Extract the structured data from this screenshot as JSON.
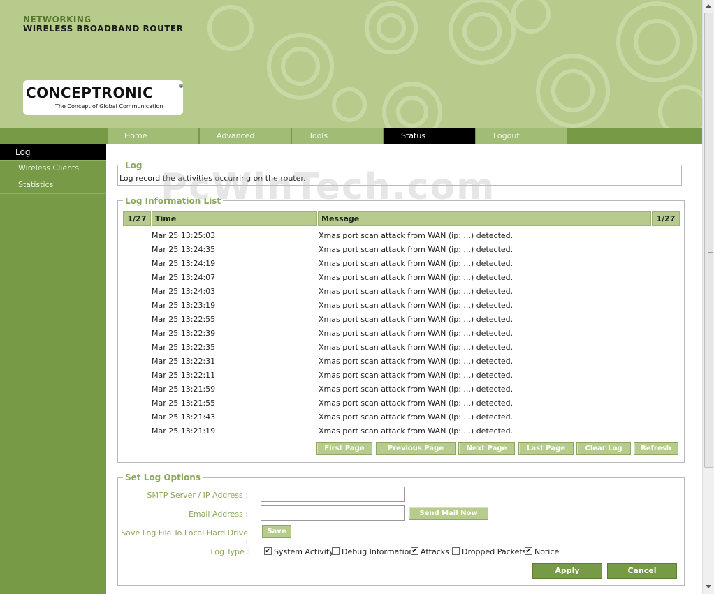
{
  "header": {
    "networking": "NETWORKING",
    "product": "WIRELESS BROADBAND ROUTER",
    "brand": "CONCEPTRONIC",
    "brand_registered": "®",
    "tagline": "The Concept of Global Communication"
  },
  "nav": {
    "tabs": [
      {
        "label": "Home"
      },
      {
        "label": "Advanced"
      },
      {
        "label": "Tools"
      },
      {
        "label": "Status"
      },
      {
        "label": "Logout"
      }
    ],
    "active": "Status"
  },
  "sidebar": {
    "items": [
      {
        "label": "Log"
      },
      {
        "label": "Wireless Clients"
      },
      {
        "label": "Statistics"
      }
    ],
    "active": "Log"
  },
  "log_section": {
    "legend": "Log",
    "description": "Log record the activities occurring on the router."
  },
  "watermark": "PcWinTech.com",
  "log_list": {
    "legend": "Log Information List",
    "page_left": "1/27",
    "page_right": "1/27",
    "col_time": "Time",
    "col_message": "Message",
    "rows": [
      {
        "time": "Mar 25 13:25:03",
        "message": "Xmas port scan attack from WAN (ip:  ...) detected."
      },
      {
        "time": "Mar 25 13:24:35",
        "message": "Xmas port scan attack from WAN (ip:  ...) detected."
      },
      {
        "time": "Mar 25 13:24:19",
        "message": "Xmas port scan attack from WAN (ip:  ...) detected."
      },
      {
        "time": "Mar 25 13:24:07",
        "message": "Xmas port scan attack from WAN (ip:  ...) detected."
      },
      {
        "time": "Mar 25 13:24:03",
        "message": "Xmas port scan attack from WAN (ip:  ...) detected."
      },
      {
        "time": "Mar 25 13:23:19",
        "message": "Xmas port scan attack from WAN (ip:  ...) detected."
      },
      {
        "time": "Mar 25 13:22:55",
        "message": "Xmas port scan attack from WAN (ip:  ...) detected."
      },
      {
        "time": "Mar 25 13:22:39",
        "message": "Xmas port scan attack from WAN (ip:  ...) detected."
      },
      {
        "time": "Mar 25 13:22:35",
        "message": "Xmas port scan attack from WAN (ip:  ...) detected."
      },
      {
        "time": "Mar 25 13:22:31",
        "message": "Xmas port scan attack from WAN (ip:  ...) detected."
      },
      {
        "time": "Mar 25 13:22:11",
        "message": "Xmas port scan attack from WAN (ip:  ...) detected."
      },
      {
        "time": "Mar 25 13:21:59",
        "message": "Xmas port scan attack from WAN (ip:  ...) detected."
      },
      {
        "time": "Mar 25 13:21:55",
        "message": "Xmas port scan attack from WAN (ip:  ...) detected."
      },
      {
        "time": "Mar 25 13:21:43",
        "message": "Xmas port scan attack from WAN (ip:  ...) detected."
      },
      {
        "time": "Mar 25 13:21:19",
        "message": "Xmas port scan attack from WAN (ip:  ...) detected."
      }
    ],
    "buttons": {
      "first": "First Page",
      "previous": "Previous Page",
      "next": "Next Page",
      "last": "Last Page",
      "clear": "Clear Log",
      "refresh": "Refresh"
    }
  },
  "options": {
    "legend": "Set Log Options",
    "smtp_label": "SMTP Server / IP Address :",
    "smtp_value": "",
    "email_label": "Email Address :",
    "email_value": "",
    "send_mail": "Send Mail Now",
    "save_label": "Save Log File To Local Hard Drive :",
    "save_button": "Save",
    "log_type_label": "Log Type :",
    "log_types": [
      {
        "label": "System Activity",
        "checked": true
      },
      {
        "label": "Debug Information",
        "checked": false
      },
      {
        "label": "Attacks",
        "checked": true
      },
      {
        "label": "Dropped Packets",
        "checked": false
      },
      {
        "label": "Notice",
        "checked": true
      }
    ],
    "apply": "Apply",
    "cancel": "Cancel"
  },
  "colors": {
    "header_bg": "#b7cc8c",
    "nav_bg": "#779a46",
    "accent_text": "#8aa95a",
    "active_tab": "#000000"
  }
}
